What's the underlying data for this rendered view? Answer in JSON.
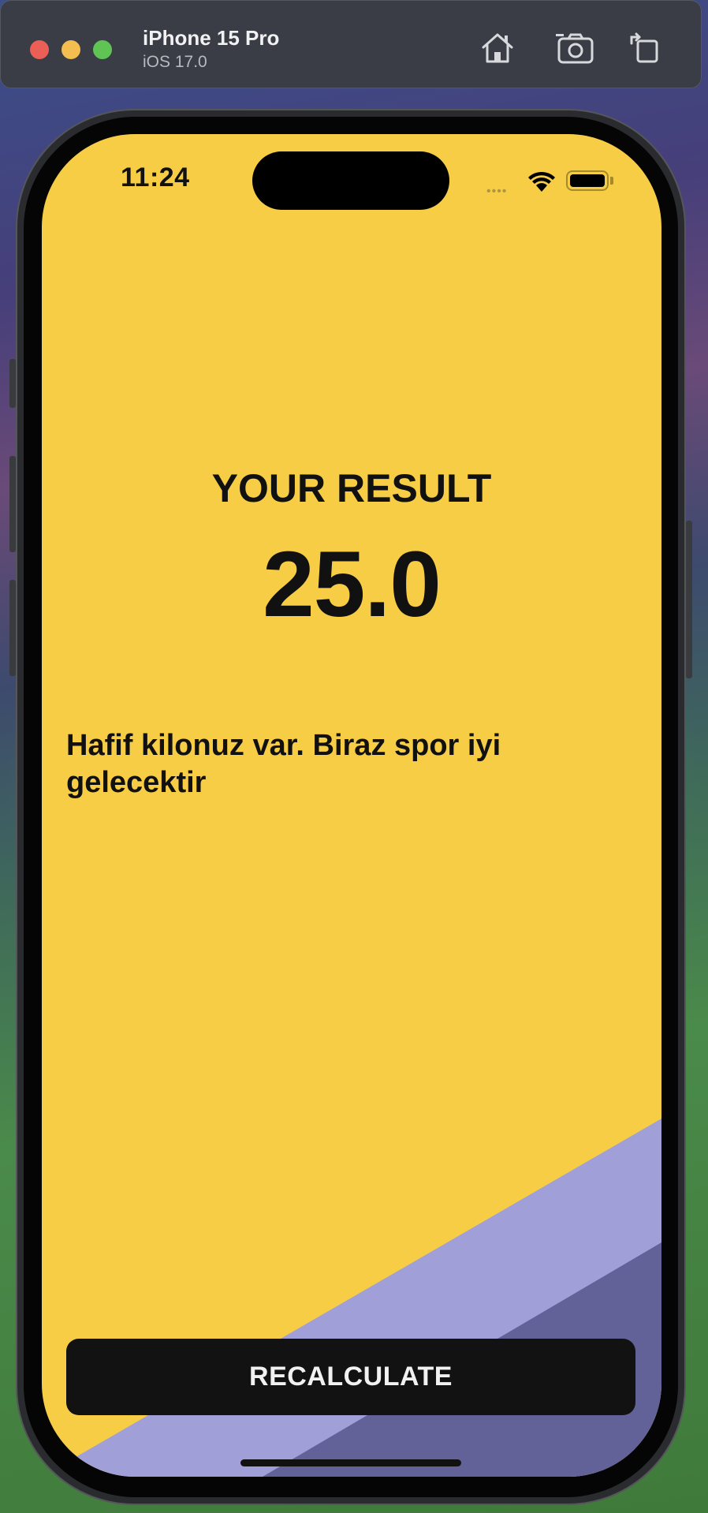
{
  "simulator": {
    "device_name": "iPhone 15 Pro",
    "os_version": "iOS 17.0",
    "toolbar_icons": [
      "home-icon",
      "screenshot-icon",
      "rotate-icon"
    ]
  },
  "status_bar": {
    "time": "11:24",
    "signal_dots": "••••"
  },
  "result": {
    "title": "YOUR RESULT",
    "value": "25.0",
    "advice": "Hafif kilonuz var. Biraz spor iyi gelecektir"
  },
  "button": {
    "recalculate_label": "RECALCULATE"
  },
  "colors": {
    "background": "#f7cd45",
    "stripe_light": "#a19fd8",
    "stripe_dark": "#626198",
    "button": "#121212"
  }
}
